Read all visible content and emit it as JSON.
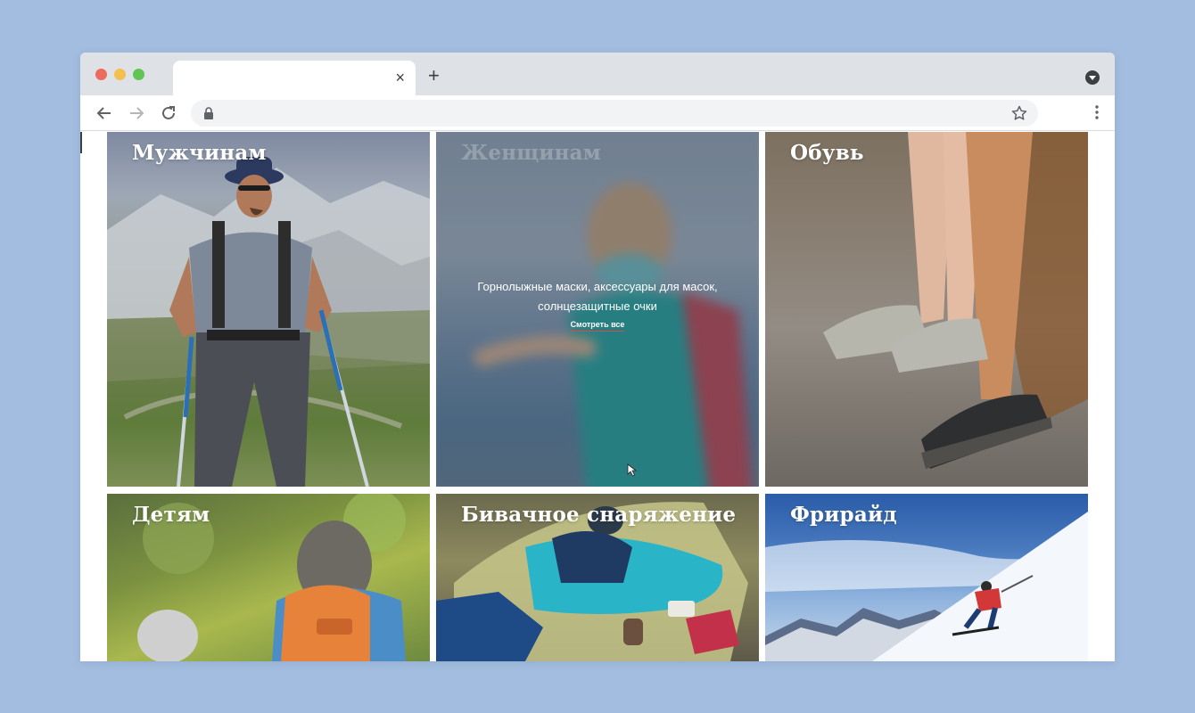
{
  "browser": {
    "tab_close_glyph": "×",
    "new_tab_glyph": "+",
    "icons": {
      "back": "arrow-left-icon",
      "forward": "arrow-right-icon",
      "reload": "reload-icon",
      "lock": "lock-icon",
      "bookmark": "star-icon",
      "menu": "kebab-menu-icon",
      "profile": "chevron-down-circle-icon"
    }
  },
  "categories": [
    {
      "title": "Мужчинам"
    },
    {
      "title": "Женщинам",
      "description": "Горнолыжные маски, аксессуары для масок, солнцезащитные очки",
      "link": "Смотреть все"
    },
    {
      "title": "Обувь"
    },
    {
      "title": "Детям"
    },
    {
      "title": "Бивачное снаряжение"
    },
    {
      "title": "Фрирайд"
    }
  ],
  "colors": {
    "page_background": "#a3bde0",
    "link_underline": "#d64b4b"
  }
}
